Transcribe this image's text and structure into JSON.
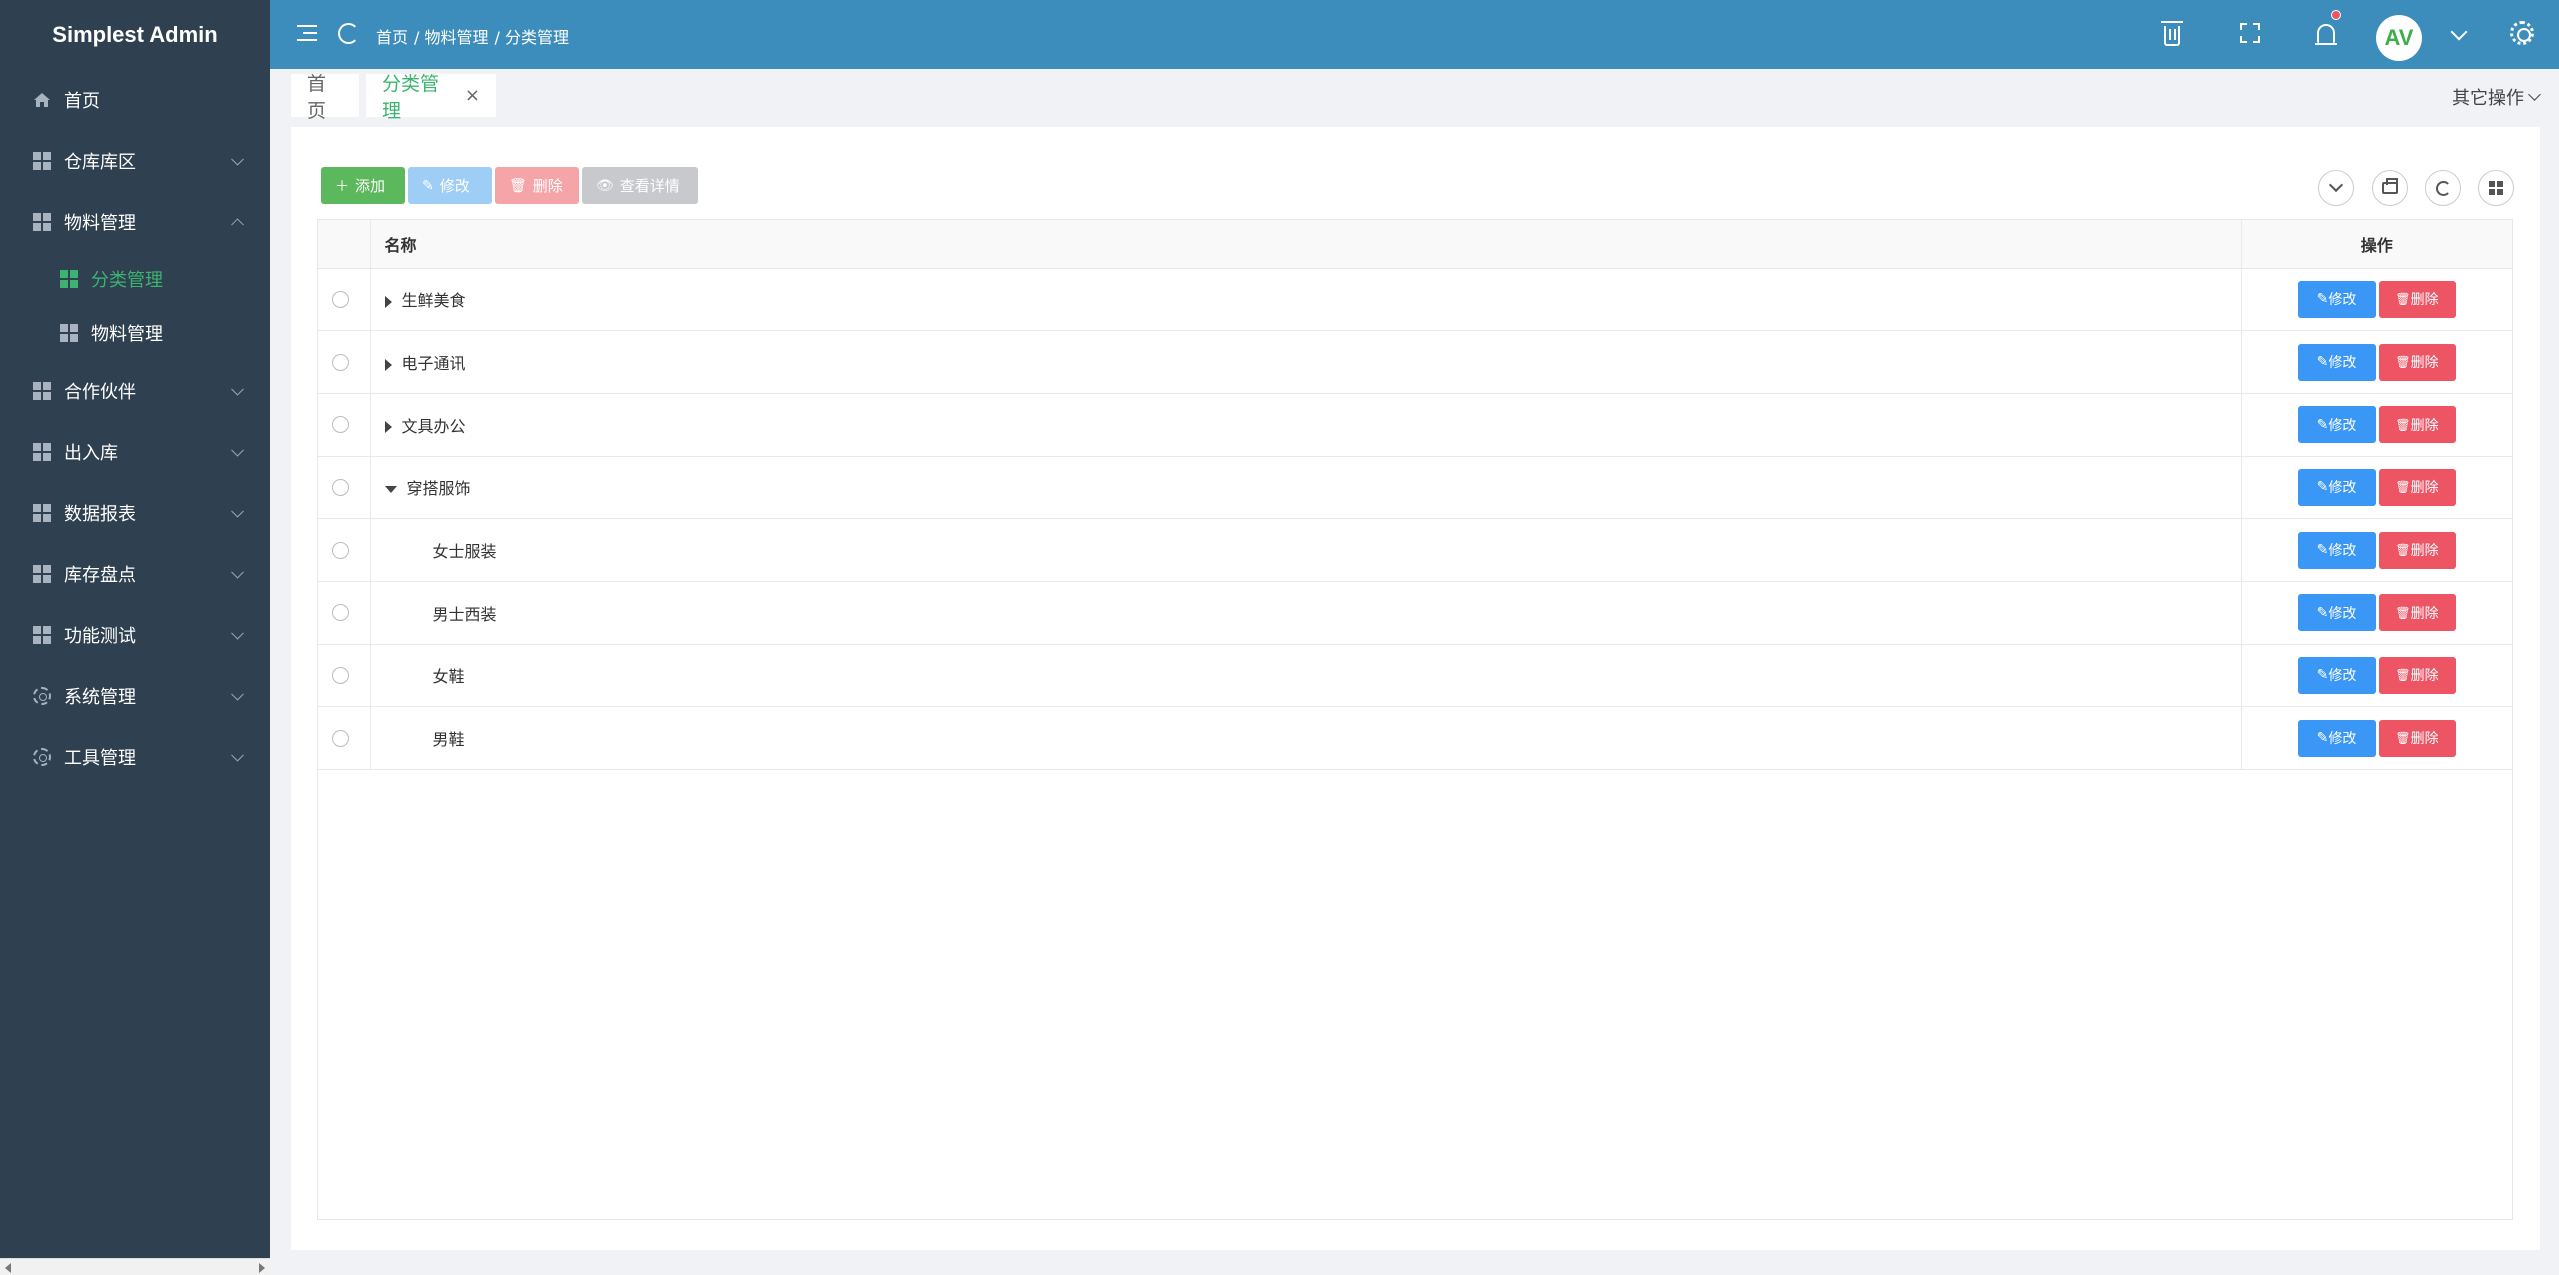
{
  "sidebar": {
    "logo": "Simplest Admin",
    "items": [
      {
        "label": "首页",
        "icon": "home-icon",
        "expandable": false
      },
      {
        "label": "仓库库区",
        "icon": "grid-icon",
        "expandable": true
      },
      {
        "label": "物料管理",
        "icon": "grid-icon",
        "expandable": true,
        "expanded": true,
        "children": [
          {
            "label": "分类管理",
            "icon": "grid-icon",
            "active": true
          },
          {
            "label": "物料管理",
            "icon": "grid-icon",
            "active": false
          }
        ]
      },
      {
        "label": "合作伙伴",
        "icon": "grid-icon",
        "expandable": true
      },
      {
        "label": "出入库",
        "icon": "grid-icon",
        "expandable": true
      },
      {
        "label": "数据报表",
        "icon": "grid-icon",
        "expandable": true
      },
      {
        "label": "库存盘点",
        "icon": "grid-icon",
        "expandable": true
      },
      {
        "label": "功能测试",
        "icon": "grid-icon",
        "expandable": true
      },
      {
        "label": "系统管理",
        "icon": "gear-icon",
        "expandable": true
      },
      {
        "label": "工具管理",
        "icon": "gear-icon",
        "expandable": true
      }
    ]
  },
  "header": {
    "breadcrumb": [
      "首页",
      "/ 物料管理",
      "/ 分类管理"
    ],
    "has_notification": true,
    "avatar_text": "AV",
    "colors": {
      "header_bg": "#3c8dbc",
      "notification_dot": "#ed5565"
    }
  },
  "tabs": {
    "items": [
      {
        "label": "首页",
        "active": false,
        "closable": false
      },
      {
        "label": "分类管理",
        "active": true,
        "closable": true,
        "close_glyph": "×"
      }
    ],
    "other_ops": "其它操作"
  },
  "toolbar": {
    "add_label": "添加",
    "edit_label": "修改",
    "delete_label": "删除",
    "view_label": "查看详情",
    "colors": {
      "add": "#5cb85c",
      "edit": "#9ecdf5",
      "delete": "#f5a5a8",
      "view": "#c7c9cc"
    }
  },
  "table": {
    "columns": [
      "名称",
      "操作"
    ],
    "edit_label": "修改",
    "delete_label": "删除",
    "rows": [
      {
        "name": "生鲜美食",
        "level": 0,
        "expander": "collapsed"
      },
      {
        "name": "电子通讯",
        "level": 0,
        "expander": "collapsed"
      },
      {
        "name": "文具办公",
        "level": 0,
        "expander": "collapsed"
      },
      {
        "name": "穿搭服饰",
        "level": 0,
        "expander": "expanded"
      },
      {
        "name": "女士服装",
        "level": 1,
        "expander": "none"
      },
      {
        "name": "男士西装",
        "level": 1,
        "expander": "none"
      },
      {
        "name": "女鞋",
        "level": 1,
        "expander": "none"
      },
      {
        "name": "男鞋",
        "level": 1,
        "expander": "none"
      }
    ]
  }
}
